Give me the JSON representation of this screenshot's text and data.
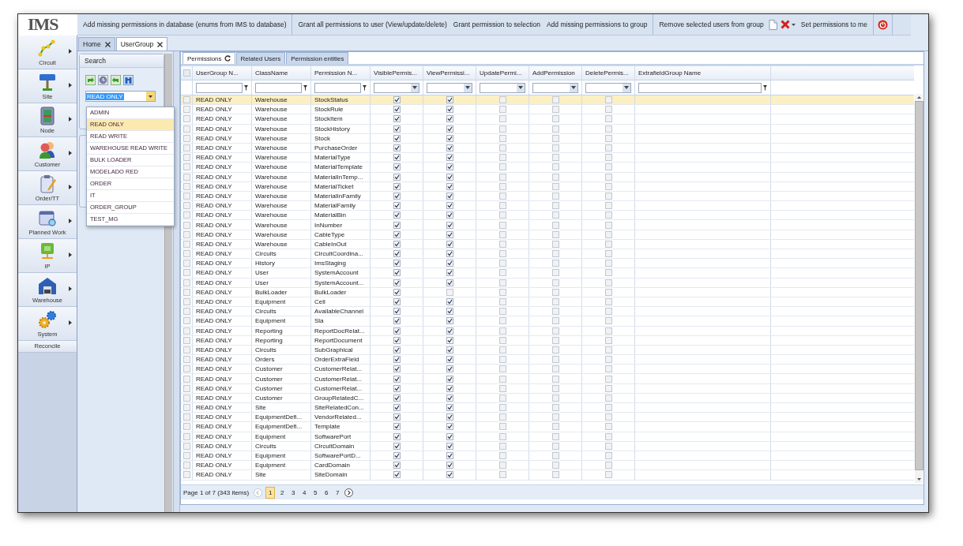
{
  "logo": "IMS",
  "toolbar": [
    "Add missing permissions in database (enums from IMS to database)",
    "Grant all permissions to user (View/update/delete)",
    "Grant permission to selection",
    "Add missing permissions to group",
    "Remove selected users from group",
    "Set permissions to me"
  ],
  "nav": [
    {
      "label": "Circuit"
    },
    {
      "label": "Site"
    },
    {
      "label": "Node"
    },
    {
      "label": "Customer"
    },
    {
      "label": "Order/TT"
    },
    {
      "label": "Planned Work"
    },
    {
      "label": "IP"
    },
    {
      "label": "Warehouse"
    },
    {
      "label": "System"
    }
  ],
  "nav_footer": "Reconcile",
  "tabs": [
    {
      "label": "Home",
      "selected": false
    },
    {
      "label": "UserGroup",
      "selected": true
    }
  ],
  "search": {
    "title": "Search",
    "group_value": "READ ONLY",
    "dropdown_open": true,
    "options": [
      {
        "label": "ADMIN",
        "selected": false
      },
      {
        "label": "READ ONLY",
        "selected": true
      },
      {
        "label": "READ WRITE",
        "selected": false
      },
      {
        "label": "WAREHOUSE READ WRITE",
        "selected": false
      },
      {
        "label": "BULK LOADER",
        "selected": false
      },
      {
        "label": "MODELADO RED",
        "selected": false
      },
      {
        "label": "ORDER",
        "selected": false
      },
      {
        "label": "IT",
        "selected": false
      },
      {
        "label": "ORDER_GROUP",
        "selected": false
      },
      {
        "label": "TEST_MG",
        "selected": false
      }
    ]
  },
  "grid": {
    "tabs": [
      {
        "label": "Permissions",
        "selected": true
      },
      {
        "label": "Related Users",
        "selected": false
      },
      {
        "label": "Permission entities",
        "selected": false
      }
    ],
    "select_all_checked": false,
    "columns": [
      "UserGroup N...",
      "ClassName",
      "Permission N...",
      "VisiblePermis...",
      "ViewPermissi...",
      "UpdatePermi...",
      "AddPermission",
      "DeletePermis...",
      "ExtrafieldGroup Name"
    ],
    "rows": [
      {
        "group": "READ ONLY",
        "class": "Warehouse",
        "permission": "StockStatus",
        "checked": false,
        "visible": true,
        "view": true,
        "update": false,
        "add": false,
        "delete": false,
        "selected": true
      },
      {
        "group": "READ ONLY",
        "class": "Warehouse",
        "permission": "StockRule",
        "checked": false,
        "visible": true,
        "view": true,
        "update": false,
        "add": false,
        "delete": false,
        "selected": false
      },
      {
        "group": "READ ONLY",
        "class": "Warehouse",
        "permission": "StockItem",
        "checked": false,
        "visible": true,
        "view": true,
        "update": false,
        "add": false,
        "delete": false,
        "selected": false
      },
      {
        "group": "READ ONLY",
        "class": "Warehouse",
        "permission": "StockHistory",
        "checked": false,
        "visible": true,
        "view": true,
        "update": false,
        "add": false,
        "delete": false,
        "selected": false
      },
      {
        "group": "READ ONLY",
        "class": "Warehouse",
        "permission": "Stock",
        "checked": false,
        "visible": true,
        "view": true,
        "update": false,
        "add": false,
        "delete": false,
        "selected": false
      },
      {
        "group": "READ ONLY",
        "class": "Warehouse",
        "permission": "PurchaseOrder",
        "checked": false,
        "visible": true,
        "view": true,
        "update": false,
        "add": false,
        "delete": false,
        "selected": false
      },
      {
        "group": "READ ONLY",
        "class": "Warehouse",
        "permission": "MaterialType",
        "checked": false,
        "visible": true,
        "view": true,
        "update": false,
        "add": false,
        "delete": false,
        "selected": false
      },
      {
        "group": "READ ONLY",
        "class": "Warehouse",
        "permission": "MaterialTemplate",
        "checked": false,
        "visible": true,
        "view": true,
        "update": false,
        "add": false,
        "delete": false,
        "selected": false
      },
      {
        "group": "READ ONLY",
        "class": "Warehouse",
        "permission": "MaterialInTemp...",
        "checked": false,
        "visible": true,
        "view": true,
        "update": false,
        "add": false,
        "delete": false,
        "selected": false
      },
      {
        "group": "READ ONLY",
        "class": "Warehouse",
        "permission": "MaterialTicket",
        "checked": false,
        "visible": true,
        "view": true,
        "update": false,
        "add": false,
        "delete": false,
        "selected": false
      },
      {
        "group": "READ ONLY",
        "class": "Warehouse",
        "permission": "MaterialInFamily",
        "checked": false,
        "visible": true,
        "view": true,
        "update": false,
        "add": false,
        "delete": false,
        "selected": false
      },
      {
        "group": "READ ONLY",
        "class": "Warehouse",
        "permission": "MaterialFamily",
        "checked": false,
        "visible": true,
        "view": true,
        "update": false,
        "add": false,
        "delete": false,
        "selected": false
      },
      {
        "group": "READ ONLY",
        "class": "Warehouse",
        "permission": "MaterialBin",
        "checked": false,
        "visible": true,
        "view": true,
        "update": false,
        "add": false,
        "delete": false,
        "selected": false
      },
      {
        "group": "READ ONLY",
        "class": "Warehouse",
        "permission": "InNumber",
        "checked": false,
        "visible": true,
        "view": true,
        "update": false,
        "add": false,
        "delete": false,
        "selected": false
      },
      {
        "group": "READ ONLY",
        "class": "Warehouse",
        "permission": "CableType",
        "checked": false,
        "visible": true,
        "view": true,
        "update": false,
        "add": false,
        "delete": false,
        "selected": false
      },
      {
        "group": "READ ONLY",
        "class": "Warehouse",
        "permission": "CableInOut",
        "checked": false,
        "visible": true,
        "view": true,
        "update": false,
        "add": false,
        "delete": false,
        "selected": false
      },
      {
        "group": "READ ONLY",
        "class": "Circuits",
        "permission": "CircuitCoordina...",
        "checked": false,
        "visible": true,
        "view": true,
        "update": false,
        "add": false,
        "delete": false,
        "selected": false
      },
      {
        "group": "READ ONLY",
        "class": "History",
        "permission": "ImsStaging",
        "checked": false,
        "visible": true,
        "view": true,
        "update": false,
        "add": false,
        "delete": false,
        "selected": false
      },
      {
        "group": "READ ONLY",
        "class": "User",
        "permission": "SystemAccount",
        "checked": false,
        "visible": true,
        "view": true,
        "update": false,
        "add": false,
        "delete": false,
        "selected": false
      },
      {
        "group": "READ ONLY",
        "class": "User",
        "permission": "SystemAccount...",
        "checked": false,
        "visible": true,
        "view": true,
        "update": false,
        "add": false,
        "delete": false,
        "selected": false
      },
      {
        "group": "READ ONLY",
        "class": "BulkLoader",
        "permission": "BulkLoader",
        "checked": false,
        "visible": true,
        "view": false,
        "update": false,
        "add": false,
        "delete": false,
        "selected": false
      },
      {
        "group": "READ ONLY",
        "class": "Equipment",
        "permission": "Cell",
        "checked": false,
        "visible": true,
        "view": true,
        "update": false,
        "add": false,
        "delete": false,
        "selected": false
      },
      {
        "group": "READ ONLY",
        "class": "Circuits",
        "permission": "AvailableChannel",
        "checked": false,
        "visible": true,
        "view": true,
        "update": false,
        "add": false,
        "delete": false,
        "selected": false
      },
      {
        "group": "READ ONLY",
        "class": "Equipment",
        "permission": "Sla",
        "checked": false,
        "visible": true,
        "view": true,
        "update": false,
        "add": false,
        "delete": false,
        "selected": false
      },
      {
        "group": "READ ONLY",
        "class": "Reporting",
        "permission": "ReportDocRelat...",
        "checked": false,
        "visible": true,
        "view": true,
        "update": false,
        "add": false,
        "delete": false,
        "selected": false
      },
      {
        "group": "READ ONLY",
        "class": "Reporting",
        "permission": "ReportDocument",
        "checked": false,
        "visible": true,
        "view": true,
        "update": false,
        "add": false,
        "delete": false,
        "selected": false
      },
      {
        "group": "READ ONLY",
        "class": "Circuits",
        "permission": "SubGraphical",
        "checked": false,
        "visible": true,
        "view": true,
        "update": false,
        "add": false,
        "delete": false,
        "selected": false
      },
      {
        "group": "READ ONLY",
        "class": "Orders",
        "permission": "OrderExtraField",
        "checked": false,
        "visible": true,
        "view": true,
        "update": false,
        "add": false,
        "delete": false,
        "selected": false
      },
      {
        "group": "READ ONLY",
        "class": "Customer",
        "permission": "CustomerRelat...",
        "checked": false,
        "visible": true,
        "view": true,
        "update": false,
        "add": false,
        "delete": false,
        "selected": false
      },
      {
        "group": "READ ONLY",
        "class": "Customer",
        "permission": "CustomerRelat...",
        "checked": false,
        "visible": true,
        "view": true,
        "update": false,
        "add": false,
        "delete": false,
        "selected": false
      },
      {
        "group": "READ ONLY",
        "class": "Customer",
        "permission": "CustomerRelat...",
        "checked": false,
        "visible": true,
        "view": true,
        "update": false,
        "add": false,
        "delete": false,
        "selected": false
      },
      {
        "group": "READ ONLY",
        "class": "Customer",
        "permission": "GroupRelatedC...",
        "checked": false,
        "visible": true,
        "view": true,
        "update": false,
        "add": false,
        "delete": false,
        "selected": false
      },
      {
        "group": "READ ONLY",
        "class": "Site",
        "permission": "SiteRelatedCon...",
        "checked": false,
        "visible": true,
        "view": true,
        "update": false,
        "add": false,
        "delete": false,
        "selected": false
      },
      {
        "group": "READ ONLY",
        "class": "EquipmentDefi...",
        "permission": "VendorRelated...",
        "checked": false,
        "visible": true,
        "view": true,
        "update": false,
        "add": false,
        "delete": false,
        "selected": false
      },
      {
        "group": "READ ONLY",
        "class": "EquipmentDefi...",
        "permission": "Template",
        "checked": false,
        "visible": true,
        "view": true,
        "update": false,
        "add": false,
        "delete": false,
        "selected": false
      },
      {
        "group": "READ ONLY",
        "class": "Equipment",
        "permission": "SoftwarePort",
        "checked": false,
        "visible": true,
        "view": true,
        "update": false,
        "add": false,
        "delete": false,
        "selected": false
      },
      {
        "group": "READ ONLY",
        "class": "Circuits",
        "permission": "CircuitDomain",
        "checked": false,
        "visible": true,
        "view": true,
        "update": false,
        "add": false,
        "delete": false,
        "selected": false
      },
      {
        "group": "READ ONLY",
        "class": "Equipment",
        "permission": "SoftwarePortD...",
        "checked": false,
        "visible": true,
        "view": true,
        "update": false,
        "add": false,
        "delete": false,
        "selected": false
      },
      {
        "group": "READ ONLY",
        "class": "Equipment",
        "permission": "CardDomain",
        "checked": false,
        "visible": true,
        "view": true,
        "update": false,
        "add": false,
        "delete": false,
        "selected": false
      },
      {
        "group": "READ ONLY",
        "class": "Site",
        "permission": "SiteDomain",
        "checked": false,
        "visible": true,
        "view": true,
        "update": false,
        "add": false,
        "delete": false,
        "selected": false
      }
    ],
    "pager": {
      "summary": "Page 1 of 7 (343 items)",
      "prev_disabled": true,
      "pages": [
        {
          "label": "1",
          "selected": true
        },
        {
          "label": "2",
          "selected": false
        },
        {
          "label": "3",
          "selected": false
        },
        {
          "label": "4",
          "selected": false
        },
        {
          "label": "5",
          "selected": false
        },
        {
          "label": "6",
          "selected": false
        },
        {
          "label": "7",
          "selected": false
        }
      ]
    }
  }
}
